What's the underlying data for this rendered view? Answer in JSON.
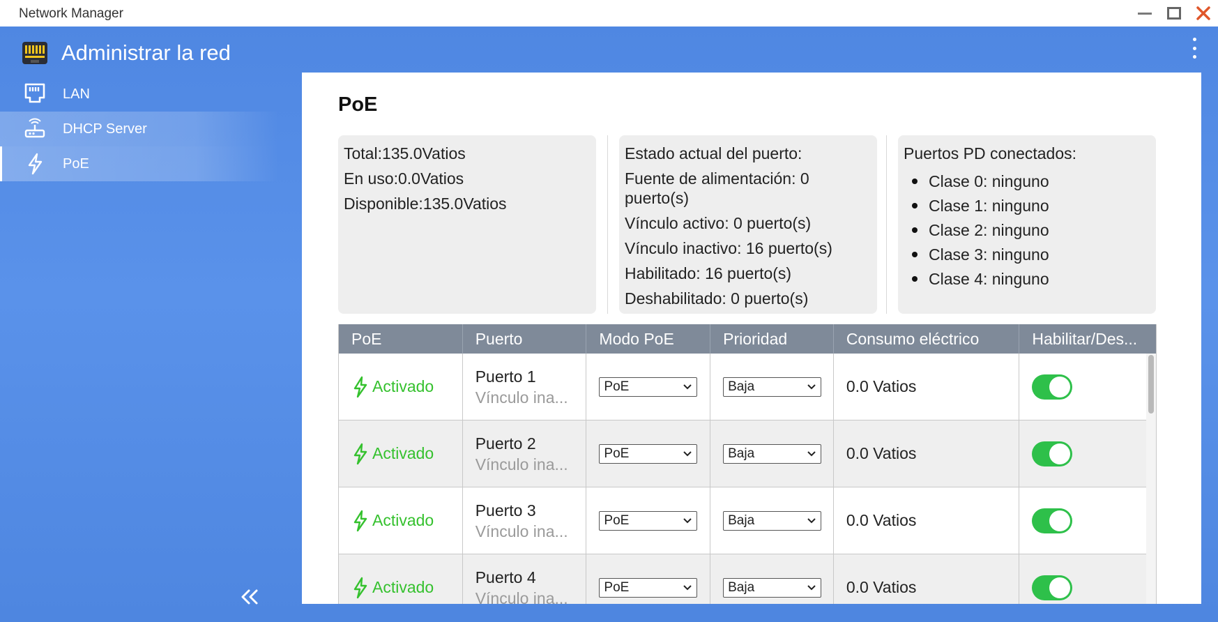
{
  "window": {
    "title": "Network Manager"
  },
  "header": {
    "title": "Administrar la red"
  },
  "sidebar": {
    "items": [
      {
        "label": "LAN",
        "icon": "ethernet-port-icon"
      },
      {
        "label": "DHCP Server",
        "icon": "router-icon"
      },
      {
        "label": "PoE",
        "icon": "lightning-icon"
      }
    ]
  },
  "panel": {
    "title": "PoE",
    "power": {
      "total": "Total:135.0Vatios",
      "in_use": "En uso:0.0Vatios",
      "available": "Disponible:135.0Vatios"
    },
    "port_status": {
      "heading": "Estado actual del puerto:",
      "source": "Fuente de alimentación: 0 puerto(s)",
      "active": "Vínculo activo: 0 puerto(s)",
      "inactive": "Vínculo inactivo: 16 puerto(s)",
      "enabled": "Habilitado: 16 puerto(s)",
      "disabled": "Deshabilitado: 0 puerto(s)"
    },
    "pd_ports": {
      "heading": "Puertos PD conectados:",
      "classes": [
        "Clase 0: ninguno",
        "Clase 1: ninguno",
        "Clase 2: ninguno",
        "Clase 3: ninguno",
        "Clase 4: ninguno"
      ]
    },
    "table": {
      "columns": [
        "PoE",
        "Puerto",
        "Modo PoE",
        "Prioridad",
        "Consumo eléctrico",
        "Habilitar/Des..."
      ],
      "rows": [
        {
          "status": "Activado",
          "port": "Puerto 1",
          "link": "Vínculo ina...",
          "mode": "PoE",
          "priority": "Baja",
          "power": "0.0 Vatios",
          "enabled": true
        },
        {
          "status": "Activado",
          "port": "Puerto 2",
          "link": "Vínculo ina...",
          "mode": "PoE",
          "priority": "Baja",
          "power": "0.0 Vatios",
          "enabled": true
        },
        {
          "status": "Activado",
          "port": "Puerto 3",
          "link": "Vínculo ina...",
          "mode": "PoE",
          "priority": "Baja",
          "power": "0.0 Vatios",
          "enabled": true
        },
        {
          "status": "Activado",
          "port": "Puerto 4",
          "link": "Vínculo ina...",
          "mode": "PoE",
          "priority": "Baja",
          "power": "0.0 Vatios",
          "enabled": true
        }
      ]
    }
  },
  "colors": {
    "accent_blue": "#4f87e2",
    "status_green": "#35c12e",
    "toggle_green": "#2ec04a",
    "close_red": "#e0562a"
  }
}
